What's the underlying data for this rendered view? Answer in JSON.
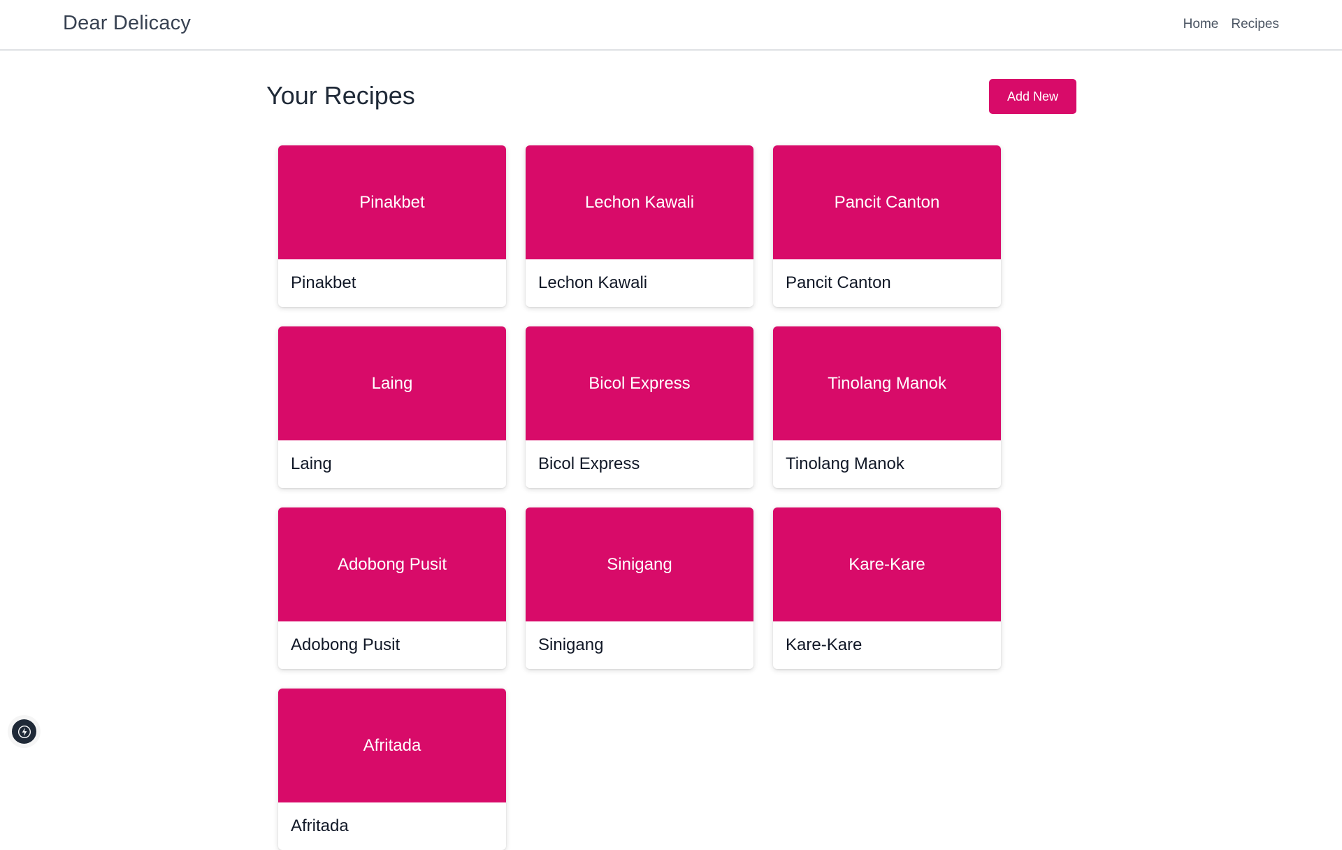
{
  "navbar": {
    "brand": "Dear Delicacy",
    "links": [
      "Home",
      "Recipes"
    ]
  },
  "main": {
    "title": "Your Recipes",
    "add_button_label": "Add New",
    "recipes": [
      {
        "banner": "Pinakbet",
        "name": "Pinakbet"
      },
      {
        "banner": "Lechon Kawali",
        "name": "Lechon Kawali"
      },
      {
        "banner": "Pancit Canton",
        "name": "Pancit Canton"
      },
      {
        "banner": "Laing",
        "name": "Laing"
      },
      {
        "banner": "Bicol Express",
        "name": "Bicol Express"
      },
      {
        "banner": "Tinolang Manok",
        "name": "Tinolang Manok"
      },
      {
        "banner": "Adobong Pusit",
        "name": "Adobong Pusit"
      },
      {
        "banner": "Sinigang",
        "name": "Sinigang"
      },
      {
        "banner": "Kare-Kare",
        "name": "Kare-Kare"
      },
      {
        "banner": "Afritada",
        "name": "Afritada"
      }
    ]
  },
  "colors": {
    "accent": "#d80b69",
    "nav_border": "#9ca3af"
  },
  "icons": {
    "corner_badge": "lightning-bolt-icon"
  }
}
